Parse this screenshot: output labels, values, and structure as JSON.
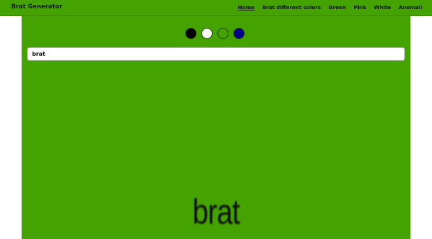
{
  "header": {
    "brand": "Brat Generator",
    "nav": [
      {
        "label": "Home"
      },
      {
        "label": "Brat different colors"
      },
      {
        "label": "Green"
      },
      {
        "label": "Pink"
      },
      {
        "label": "White"
      },
      {
        "label": "Anomali"
      }
    ]
  },
  "colors": {
    "brat_green": "#44a300",
    "swatches": [
      "#000000",
      "#ffffff",
      "#44a300",
      "#00008b"
    ]
  },
  "input": {
    "value": "brat"
  },
  "preview": {
    "text": "brat"
  }
}
